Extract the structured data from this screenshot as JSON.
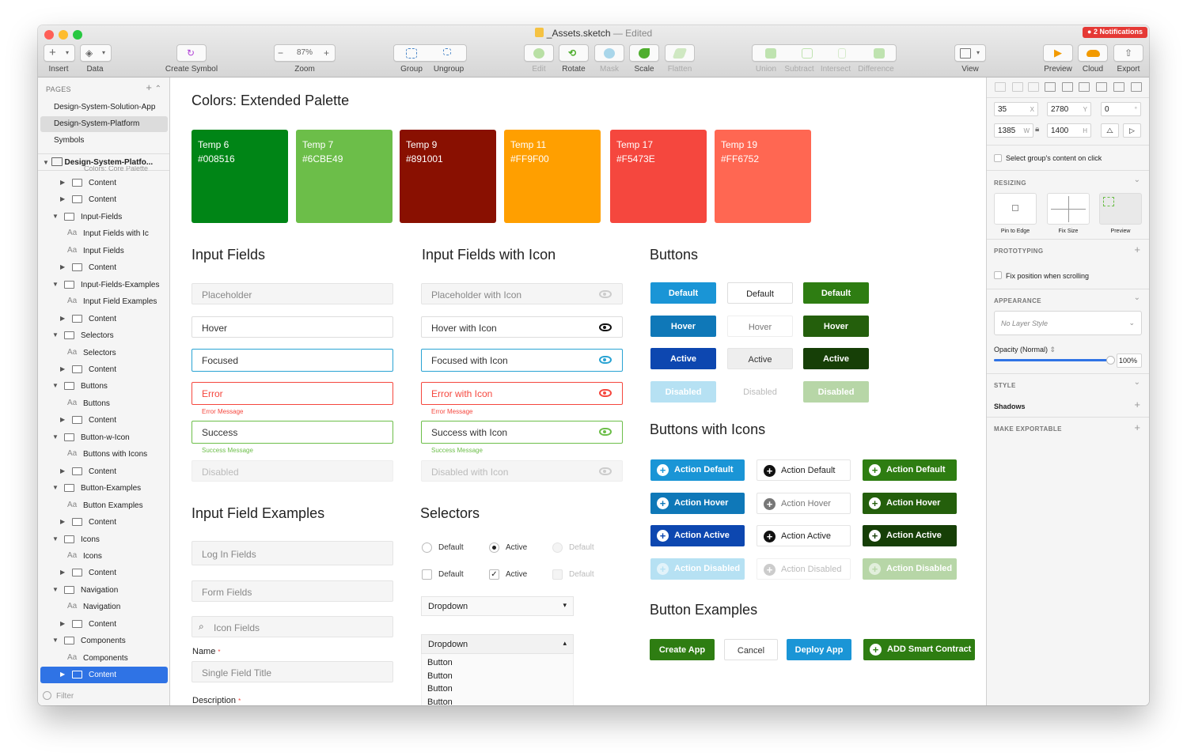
{
  "window": {
    "doc_title": "_Assets.sketch",
    "doc_status": "— Edited",
    "notifications": "2 Notifications"
  },
  "toolbar": {
    "insert": "Insert",
    "data": "Data",
    "create_symbol": "Create Symbol",
    "zoom_label": "Zoom",
    "zoom_value": "87%",
    "group": "Group",
    "ungroup": "Ungroup",
    "edit": "Edit",
    "rotate": "Rotate",
    "mask": "Mask",
    "scale": "Scale",
    "flatten": "Flatten",
    "union": "Union",
    "subtract": "Subtract",
    "intersect": "Intersect",
    "difference": "Difference",
    "view": "View",
    "preview": "Preview",
    "cloud": "Cloud",
    "export": "Export",
    "zoom_minus": "−",
    "zoom_plus": "+"
  },
  "sidebar": {
    "pages_header": "PAGES",
    "pages": [
      "Design-System-Solution-App",
      "Design-System-Platform",
      "Symbols"
    ],
    "artboard": "Design-System-Platfo...",
    "layers": [
      {
        "kind": "folder",
        "depth": 1,
        "open": false,
        "label": "Content"
      },
      {
        "kind": "folder",
        "depth": 1,
        "open": false,
        "label": "Content"
      },
      {
        "kind": "folder",
        "depth": 0,
        "open": true,
        "label": "Input-Fields"
      },
      {
        "kind": "text",
        "depth": 1,
        "label": "Input Fields with Ic"
      },
      {
        "kind": "text",
        "depth": 1,
        "label": "Input Fields"
      },
      {
        "kind": "folder",
        "depth": 1,
        "open": false,
        "label": "Content"
      },
      {
        "kind": "folder",
        "depth": 0,
        "open": true,
        "label": "Input-Fields-Examples"
      },
      {
        "kind": "text",
        "depth": 1,
        "label": "Input Field Examples"
      },
      {
        "kind": "folder",
        "depth": 1,
        "open": false,
        "label": "Content"
      },
      {
        "kind": "folder",
        "depth": 0,
        "open": true,
        "label": "Selectors"
      },
      {
        "kind": "text",
        "depth": 1,
        "label": "Selectors"
      },
      {
        "kind": "folder",
        "depth": 1,
        "open": false,
        "label": "Content"
      },
      {
        "kind": "folder",
        "depth": 0,
        "open": true,
        "label": "Buttons"
      },
      {
        "kind": "text",
        "depth": 1,
        "label": "Buttons"
      },
      {
        "kind": "folder",
        "depth": 1,
        "open": false,
        "label": "Content"
      },
      {
        "kind": "folder",
        "depth": 0,
        "open": true,
        "label": "Button-w-Icon"
      },
      {
        "kind": "text",
        "depth": 1,
        "label": "Buttons with Icons"
      },
      {
        "kind": "folder",
        "depth": 1,
        "open": false,
        "label": "Content"
      },
      {
        "kind": "folder",
        "depth": 0,
        "open": true,
        "label": "Button-Examples"
      },
      {
        "kind": "text",
        "depth": 1,
        "label": "Button Examples"
      },
      {
        "kind": "folder",
        "depth": 1,
        "open": false,
        "label": "Content"
      },
      {
        "kind": "folder",
        "depth": 0,
        "open": true,
        "label": "Icons"
      },
      {
        "kind": "text",
        "depth": 1,
        "label": "Icons"
      },
      {
        "kind": "folder",
        "depth": 1,
        "open": false,
        "label": "Content"
      },
      {
        "kind": "folder",
        "depth": 0,
        "open": true,
        "label": "Navigation"
      },
      {
        "kind": "text",
        "depth": 1,
        "label": "Navigation"
      },
      {
        "kind": "folder",
        "depth": 1,
        "open": false,
        "label": "Content"
      },
      {
        "kind": "folder",
        "depth": 0,
        "open": true,
        "label": "Components"
      },
      {
        "kind": "text",
        "depth": 1,
        "label": "Components"
      },
      {
        "kind": "folder",
        "depth": 1,
        "open": false,
        "label": "Content",
        "selected": true
      }
    ],
    "filter": "Filter"
  },
  "canvas": {
    "palette_title": "Colors: Extended Palette",
    "swatches": [
      {
        "name": "Temp 6",
        "hex": "#008516"
      },
      {
        "name": "Temp 7",
        "hex": "#6CBE49"
      },
      {
        "name": "Temp 9",
        "hex": "#891001"
      },
      {
        "name": "Temp 11",
        "hex": "#FF9F00"
      },
      {
        "name": "Temp 17",
        "hex": "#F5473E"
      },
      {
        "name": "Temp 19",
        "hex": "#FF6752"
      }
    ],
    "input_fields": {
      "title": "Input Fields",
      "placeholder": "Placeholder",
      "hover": "Hover",
      "focused": "Focused",
      "error": "Error",
      "error_msg": "Error Message",
      "success": "Success",
      "success_msg": "Success Message",
      "disabled": "Disabled"
    },
    "input_icon": {
      "title": "Input Fields with Icon",
      "placeholder": "Placeholder with Icon",
      "hover": "Hover with Icon",
      "focused": "Focused with Icon",
      "error": "Error with Icon",
      "error_msg": "Error Message",
      "success": "Success with Icon",
      "success_msg": "Success Message",
      "disabled": "Disabled with Icon"
    },
    "buttons": {
      "title": "Buttons",
      "default": "Default",
      "hover": "Hover",
      "active": "Active",
      "disabled": "Disabled"
    },
    "buttons_icons": {
      "title": "Buttons with Icons",
      "default": "Action Default",
      "hover": "Action Hover",
      "active": "Action Active",
      "disabled": "Action Disabled"
    },
    "examples": {
      "title": "Input Field Examples",
      "login": "Log In Fields",
      "form": "Form Fields",
      "icon": "Icon Fields",
      "name_label": "Name",
      "name_ph": "Single Field Title",
      "desc_label": "Description"
    },
    "selectors": {
      "title": "Selectors",
      "default": "Default",
      "active": "Active",
      "disabled": "Default",
      "dropdown": "Dropdown",
      "options": [
        "Button",
        "Button",
        "Button",
        "Button"
      ]
    },
    "button_examples": {
      "title": "Button Examples",
      "create": "Create App",
      "cancel": "Cancel",
      "deploy": "Deploy App",
      "smart": "ADD Smart Contract"
    }
  },
  "inspector": {
    "x": "35",
    "x_u": "X",
    "y": "2780",
    "y_u": "Y",
    "rot": "0",
    "rot_u": "°",
    "w": "1385",
    "w_u": "W",
    "h": "1400",
    "h_u": "H",
    "select_group": "Select group's content on click",
    "resizing": "RESIZING",
    "pin": "Pin to Edge",
    "fix": "Fix Size",
    "preview": "Preview",
    "prototyping": "PROTOTYPING",
    "fix_scroll": "Fix position when scrolling",
    "appearance": "APPEARANCE",
    "layer_style": "No Layer Style",
    "opacity_label": "Opacity (Normal)",
    "opacity": "100%",
    "opacity_level": 1.0,
    "style": "STYLE",
    "shadows": "Shadows",
    "exportable": "MAKE EXPORTABLE"
  },
  "colors": {
    "blue": "#1a95d6",
    "blue_hover": "#0f78b8",
    "blue_active": "#0d47b0",
    "blue_dis": "#b6e1f3",
    "green": "#2e7d12",
    "green_hover": "#245f0c",
    "green_active": "#163f07",
    "green_dis": "#b7d6a7",
    "error": "#F5473E",
    "success": "#6CBE49",
    "focus": "#29a3d3",
    "select": "#2f73e5"
  }
}
